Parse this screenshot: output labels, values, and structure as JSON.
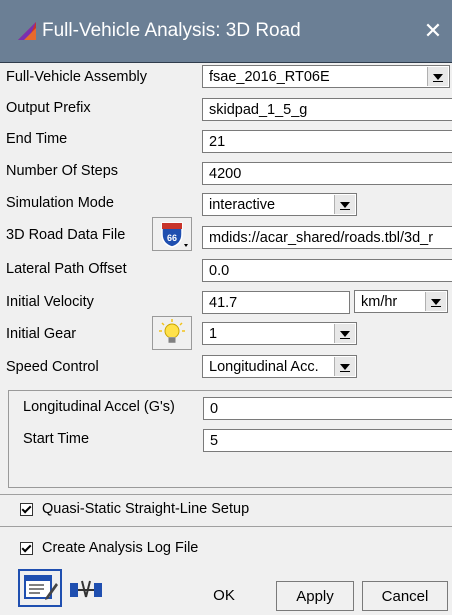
{
  "window": {
    "title": "Full-Vehicle Analysis: 3D Road",
    "close_glyph": "✕"
  },
  "form": {
    "assembly": {
      "label": "Full-Vehicle Assembly",
      "value": "fsae_2016_RT06E"
    },
    "output_prefix": {
      "label": "Output Prefix",
      "value": "skidpad_1_5_g"
    },
    "end_time": {
      "label": "End Time",
      "value": "21"
    },
    "num_steps": {
      "label": "Number Of Steps",
      "value": "4200"
    },
    "sim_mode": {
      "label": "Simulation Mode",
      "value": "interactive"
    },
    "road_file": {
      "label": "3D Road Data File",
      "value": "mdids://acar_shared/roads.tbl/3d_r",
      "icon": "interstate-66-sign-icon"
    },
    "lateral_offset": {
      "label": "Lateral Path Offset",
      "value": "0.0"
    },
    "initial_velocity": {
      "label": "Initial Velocity",
      "value": "41.7",
      "unit": "km/hr"
    },
    "initial_gear": {
      "label": "Initial Gear",
      "value": "1",
      "icon": "lightbulb-icon"
    },
    "speed_control": {
      "label": "Speed Control",
      "value": "Longitudinal Acc."
    }
  },
  "subpanel": {
    "long_accel": {
      "label": "Longitudinal Accel (G's)",
      "value": "0"
    },
    "start_time": {
      "label": "Start Time",
      "value": "5"
    }
  },
  "options": {
    "quasi_static": {
      "label": "Quasi-Static Straight-Line Setup",
      "checked": true
    },
    "analysis_log": {
      "label": "Create Analysis Log File",
      "checked": true
    }
  },
  "buttons": {
    "ok": "OK",
    "apply": "Apply",
    "cancel": "Cancel"
  },
  "colors": {
    "titlebar": "#6b7f95",
    "window_bg": "#f0f0f0",
    "field_bg": "#ffffff"
  }
}
